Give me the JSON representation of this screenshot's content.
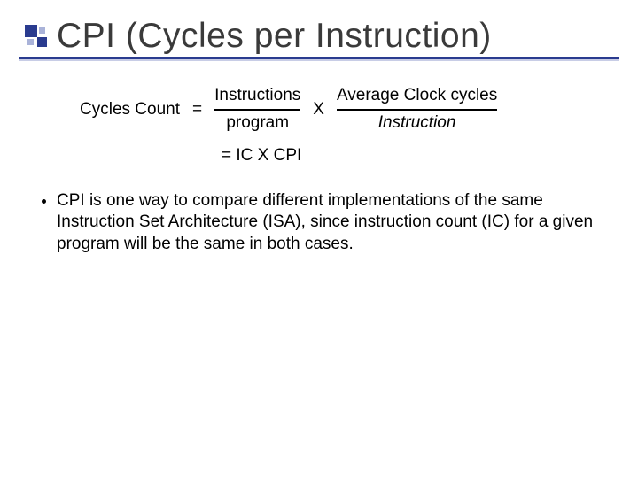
{
  "title": "CPI (Cycles per Instruction)",
  "formula": {
    "lhs": "Cycles Count",
    "eq": "=",
    "frac1": {
      "num": "Instructions",
      "den": "program"
    },
    "mult": "X",
    "frac2": {
      "num": "Average Clock cycles",
      "den": "Instruction"
    },
    "line2": "=  IC  X CPI"
  },
  "bullet": "CPI is one way to compare different implementations of the same Instruction Set Architecture (ISA), since instruction count (IC) for a given program will be the same in both cases."
}
